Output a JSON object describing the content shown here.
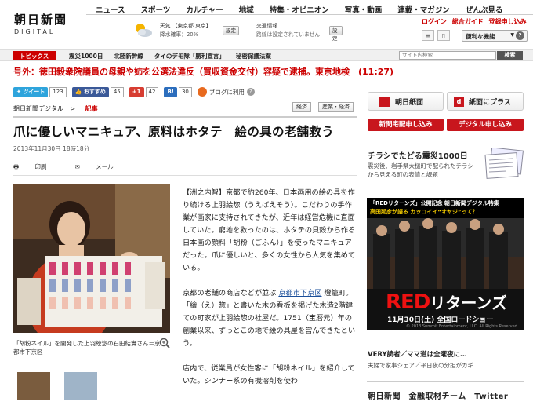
{
  "header": {
    "logo_jp": "朝日新聞",
    "logo_en": "DIGITAL",
    "nav": [
      "ニュース",
      "スポーツ",
      "カルチャー",
      "地域",
      "特集・オピニオン",
      "写真・動画",
      "連載・マガジン",
      "ぜんぶ見る"
    ],
    "weather_line1": "天気 【東京都 東京】",
    "weather_line2": "降水確率：20%",
    "weather_set": "設定",
    "traffic_line1": "交通情報",
    "traffic_line2": "路線は設定されていません",
    "traffic_set": "設定",
    "login": "ログイン",
    "sougou": "総合ガイド",
    "register": "登録申し込み",
    "benri": "便利な機能",
    "help": "?"
  },
  "topics": {
    "label": "トピックス",
    "items": [
      "震災1000日",
      "北陸新幹線",
      "タイのデモ隊「勝利宣言」",
      "秘密保護法案"
    ],
    "search_placeholder": "サイト内検索",
    "search_button": "検索"
  },
  "breaking": "号外：徳田毅衆院議員の母親や姉を公選法違反（買収資金交付）容疑で逮捕。東京地検　(11:27)",
  "social": {
    "tweet": "ツイート",
    "tweet_count": "123",
    "osusume": "おすすめ",
    "osusume_count": "45",
    "gplus": "+1",
    "gplus_count": "42",
    "hatena": "B!",
    "hatena_count": "30",
    "blog": "ブログに利用"
  },
  "breadcrumb": {
    "site": "朝日新聞デジタル",
    "sep": ">",
    "current": "記事"
  },
  "tags": [
    "経済",
    "産業・経済"
  ],
  "article": {
    "title": "爪に優しいマニキュア、原料はホタテ　絵の具の老舗救う",
    "date": "2013年11月30日 18時18分",
    "print": "印刷",
    "mail": "メール",
    "caption": "「胡粉ネイル」を開発した上羽絵惣の石田結實さん＝京都市下京区",
    "para1": "【洲之内智】京都で約260年、日本画用の絵の具を作り続ける上羽絵惣（うえばえそう）。こだわりの手作業が画家に支持されてきたが、近年は経営危機に直面していた。窮地を救ったのは、ホタテの貝殻から作る日本画の顔料「胡粉（ごふん）」を使ったマニキュアだった。爪に優しいと、多くの女性から人気を集めている。",
    "para2_a": "京都の老舗の商店などが並ぶ",
    "para2_link": "京都市下京区",
    "para2_b": "燈籠町。「繪（え）惣」と書いた木の看板を掲げた木造2階建ての町家が上羽絵惣の社屋だ。1751（宝暦元）年の創業以来、ずっとこの地で絵の具屋を営んできたという。",
    "para3": "店内で、従業員が女性客に「胡粉ネイル」を紹介していた。シンナー系の有機溶剤を使わ"
  },
  "right": {
    "shimen": "朝日紙面",
    "plus": "紙面にプラス",
    "takuhai": "新聞宅配申し込み",
    "digital": "デジタル申し込み",
    "chirashi_title": "チラシでたどる震災1000日",
    "chirashi_desc": "震災後、岩手県大槌町で配られたチラシから見える町の表情と課題",
    "ad_top1": "「REDリターンズ」公開記念 朝日新聞デジタル特集",
    "ad_top2": "高田延彦が語る カッコイイ“オヤジ”って？",
    "ad_title": "RED",
    "ad_title2": "リターンズ",
    "ad_date": "11月30日(土) 全国ロードショー",
    "ad_copy": "© 2013 Summit Entertainment, LLC. All Rights Reserved.",
    "very_title": "VERY読者／ママ道は全曜夜に…",
    "very_desc": "夫婦で家事シェア／平日夜の分担がカギ",
    "twitter": "朝日新聞　金融取材チーム　Twitter"
  }
}
